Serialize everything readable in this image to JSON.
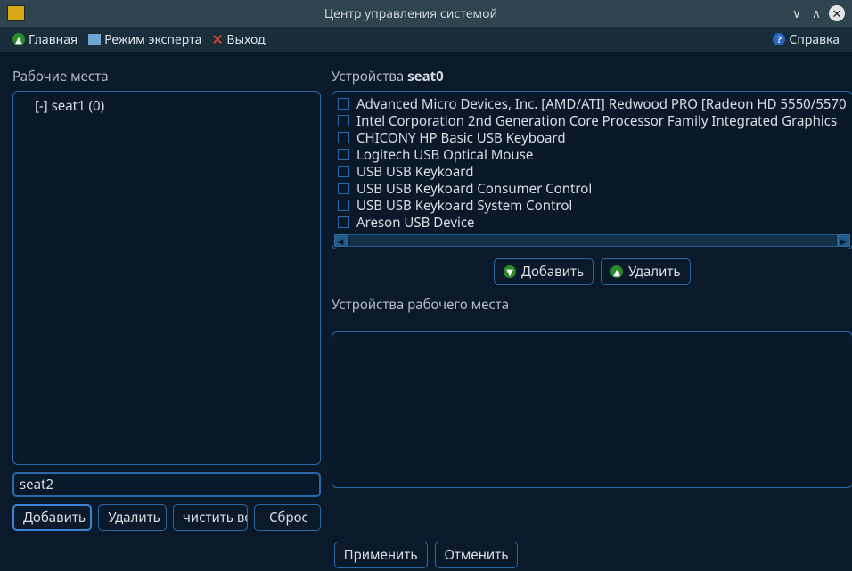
{
  "window": {
    "title": "Центр управления системой"
  },
  "menu": {
    "home": "Главная",
    "expert": "Режим эксперта",
    "exit": "Выход",
    "help": "Справка"
  },
  "left": {
    "header": "Рабочие места",
    "tree_item": "[-] seat1 (0)",
    "input_value": "seat2",
    "btn_add": "Добавить",
    "btn_delete": "Удалить",
    "btn_clear": "чистить вс",
    "btn_reset": "Сброс"
  },
  "right": {
    "devices_header_prefix": "Устройства ",
    "devices_header_seat": "seat0",
    "devices": [
      "Advanced Micro Devices, Inc. [AMD/ATI] Redwood PRO [Radeon HD 5550/5570",
      "Intel Corporation 2nd Generation Core Processor Family Integrated Graphics",
      "CHICONY HP Basic USB Keyboard",
      "Logitech USB Optical Mouse",
      "USB USB Keykoard",
      "USB USB Keykoard Consumer Control",
      "USB USB Keykoard System Control",
      "Areson USB Device"
    ],
    "btn_add": "Добавить",
    "btn_remove": "Удалить",
    "seat_devices_header": "Устройства рабочего места"
  },
  "bottom": {
    "apply": "Применить",
    "cancel": "Отменить"
  }
}
